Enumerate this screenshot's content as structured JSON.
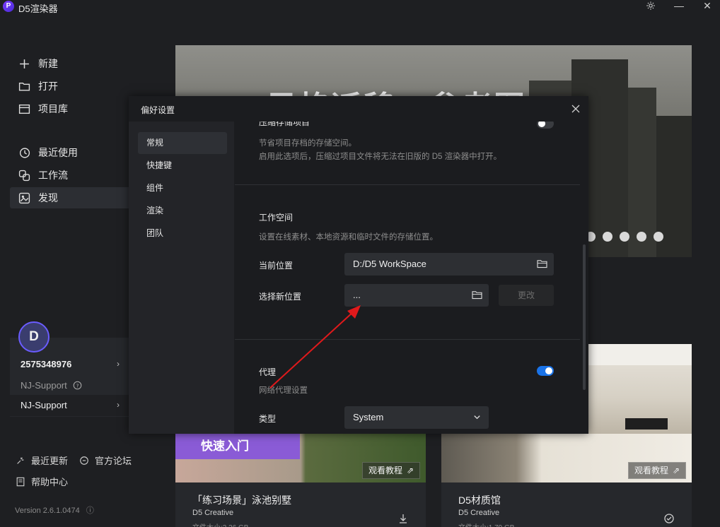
{
  "app": {
    "title": "D5渲染器",
    "logo": "P"
  },
  "left_nav": {
    "items": [
      {
        "label": "新建",
        "icon": "plus-icon"
      },
      {
        "label": "打开",
        "icon": "folder-icon"
      },
      {
        "label": "项目库",
        "icon": "library-icon"
      },
      {
        "label": "最近使用",
        "icon": "history-icon"
      },
      {
        "label": "工作流",
        "icon": "workflow-icon"
      },
      {
        "label": "发现",
        "icon": "discover-icon"
      }
    ],
    "active": "发现"
  },
  "user": {
    "avatar_letter": "D",
    "id": "2575348976",
    "team_muted": "NJ-Support",
    "team_active": "NJ-Support"
  },
  "footer": {
    "recent_updates": "最近更新",
    "forum": "官方论坛",
    "help": "帮助中心",
    "version": "Version 2.6.1.0474"
  },
  "banner": {
    "title": "AI风格迁移：参考图"
  },
  "cards": [
    {
      "tag": "快速入门",
      "title": "「练习场景」泳池别墅",
      "author": "D5 Creative",
      "size": "文件大小:3.36 GB",
      "watch_label": "观看教程"
    },
    {
      "title": "D5材质馆",
      "author": "D5 Creative",
      "size": "文件大小:1.79 GB",
      "watch_label": "观看教程"
    }
  ],
  "modal": {
    "title": "偏好设置",
    "tabs": [
      "常规",
      "快捷键",
      "组件",
      "渲染",
      "团队"
    ],
    "active_tab": "常规",
    "compress": {
      "label": "压缩存储项目",
      "desc1": "节省项目存档的存储空间。",
      "desc2": "启用此选项后，压缩过项目文件将无法在旧版的 D5 渲染器中打开。",
      "enabled": false
    },
    "workspace": {
      "title": "工作空间",
      "desc": "设置在线素材、本地资源和临时文件的存储位置。",
      "current_label": "当前位置",
      "current_value": "D:/D5 WorkSpace",
      "new_label": "选择新位置",
      "new_value": "...",
      "change_btn": "更改"
    },
    "proxy": {
      "label": "代理",
      "desc": "网络代理设置",
      "enabled": true,
      "type_label": "类型",
      "type_value": "System"
    }
  },
  "colors": {
    "accent": "#1a73e8",
    "purple_tag": "#8a5bd6",
    "arrow": "#e0191b"
  }
}
